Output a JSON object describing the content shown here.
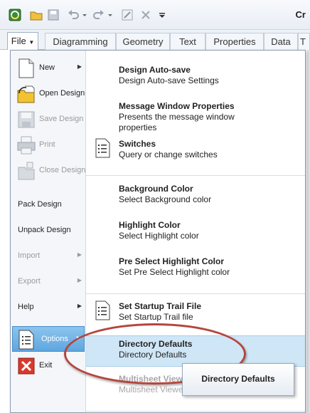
{
  "app": {
    "title_fragment": "Cr"
  },
  "ribbon": {
    "file_label": "File",
    "tabs": [
      "Diagramming",
      "Geometry",
      "Text",
      "Properties",
      "Data",
      "T"
    ]
  },
  "file_menu": {
    "left_items": {
      "new": "New",
      "open_design": "Open Design",
      "save_design": "Save Design",
      "print": "Print",
      "close_design": "Close Design",
      "pack_design": "Pack Design",
      "unpack_design": "Unpack Design",
      "import": "Import",
      "export": "Export",
      "help": "Help",
      "options": "Options",
      "exit": "Exit"
    },
    "options_submenu": [
      {
        "title": "Design Auto-save",
        "desc": "Design Auto-save Settings"
      },
      {
        "title": "Message Window Properties",
        "desc": "Presents the message window",
        "desc2": "properties"
      },
      {
        "title": "Switches",
        "desc": "Query or change switches"
      },
      {
        "title": "Background Color",
        "desc": "Select Background color"
      },
      {
        "title": "Highlight Color",
        "desc": "Select Highlight color"
      },
      {
        "title": "Pre Select Highlight Color",
        "desc": "Set Pre Select Highlight color"
      },
      {
        "title": "Set Startup Trail File",
        "desc": "Set Startup Trail file"
      },
      {
        "title": "Directory Defaults",
        "desc": "Directory Defaults"
      },
      {
        "title": "Multisheet View",
        "desc": "Multisheet Viewe"
      }
    ]
  },
  "tooltip": {
    "text": "Directory Defaults"
  },
  "colors": {
    "highlight": "#cfe6f6",
    "options_selected": "#5ea6df",
    "annotation": "#b5453c"
  }
}
